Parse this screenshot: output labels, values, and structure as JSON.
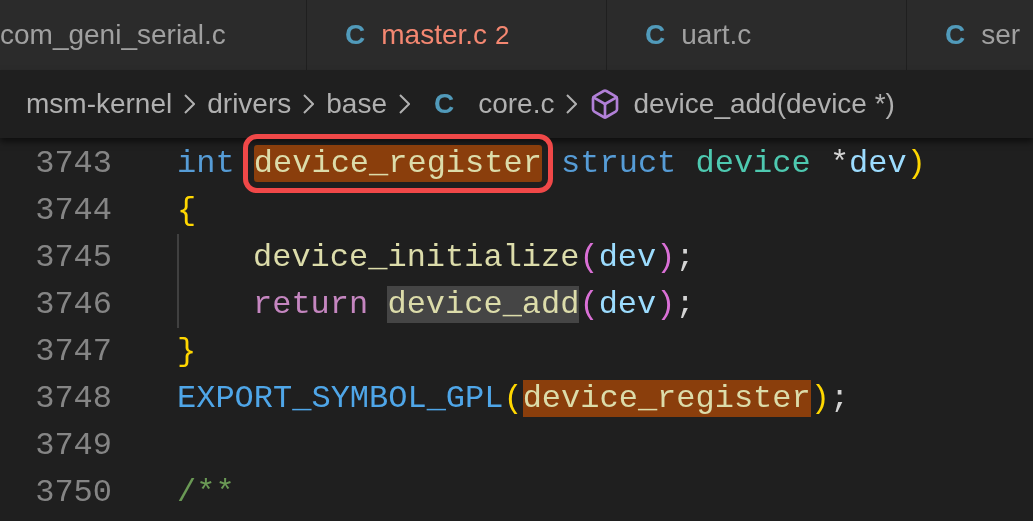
{
  "tabs": [
    {
      "label": "com_geni_serial.c",
      "kind": "cut"
    },
    {
      "label": "master.c",
      "kind": "error",
      "icon": "C",
      "problems": "2"
    },
    {
      "label": "uart.c",
      "kind": "normal",
      "icon": "C"
    },
    {
      "label": "ser",
      "kind": "normal",
      "icon": "C"
    }
  ],
  "breadcrumbs": [
    {
      "label": "msm-kernel",
      "kind": "folder"
    },
    {
      "label": "drivers",
      "kind": "folder"
    },
    {
      "label": "base",
      "kind": "folder"
    },
    {
      "label": "core.c",
      "kind": "file",
      "icon": "C"
    },
    {
      "label": "device_add(device *)",
      "kind": "symbol"
    }
  ],
  "lines": [
    {
      "number": "3743",
      "indent": false,
      "tokens": [
        {
          "t": "int ",
          "kind": "keyword"
        },
        {
          "t": "device_register",
          "kind": "function",
          "matched": true,
          "annotated": true
        },
        {
          "t": " struct ",
          "kind": "keyword"
        },
        {
          "t": "device ",
          "kind": "type"
        },
        {
          "t": "*",
          "kind": "punct"
        },
        {
          "t": "dev",
          "kind": "param"
        },
        {
          "t": ")",
          "kind": "bracket1"
        }
      ]
    },
    {
      "number": "3744",
      "indent": false,
      "tokens": [
        {
          "t": "{",
          "kind": "bracket1"
        }
      ]
    },
    {
      "number": "3745",
      "indent": true,
      "tokens": [
        {
          "t": "device_initialize",
          "kind": "function"
        },
        {
          "t": "(",
          "kind": "bracket2"
        },
        {
          "t": "dev",
          "kind": "param"
        },
        {
          "t": ")",
          "kind": "bracket2"
        },
        {
          "t": ";",
          "kind": "punct"
        }
      ]
    },
    {
      "number": "3746",
      "indent": true,
      "tokens": [
        {
          "t": "return ",
          "kind": "control"
        },
        {
          "t": "device_add",
          "kind": "function",
          "selected": true
        },
        {
          "t": "(",
          "kind": "bracket2"
        },
        {
          "t": "dev",
          "kind": "param"
        },
        {
          "t": ")",
          "kind": "bracket2"
        },
        {
          "t": ";",
          "kind": "punct"
        }
      ]
    },
    {
      "number": "3747",
      "indent": false,
      "tokens": [
        {
          "t": "}",
          "kind": "bracket1"
        }
      ]
    },
    {
      "number": "3748",
      "indent": false,
      "tokens": [
        {
          "t": "EXPORT_SYMBOL_GPL",
          "kind": "macro"
        },
        {
          "t": "(",
          "kind": "bracket1"
        },
        {
          "t": "device_register",
          "kind": "function",
          "matched": true
        },
        {
          "t": ")",
          "kind": "bracket1"
        },
        {
          "t": ";",
          "kind": "punct"
        }
      ]
    },
    {
      "number": "3749",
      "indent": false
    },
    {
      "number": "3750",
      "indent": false,
      "tokens": [
        {
          "t": "/**",
          "kind": "comment"
        }
      ]
    }
  ]
}
